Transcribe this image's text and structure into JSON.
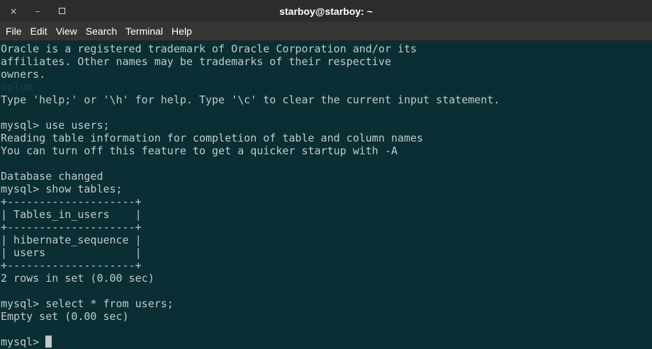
{
  "window": {
    "title": "starboy@starboy: ~",
    "controls": {
      "close_glyph": "×",
      "minimize_glyph": "–"
    }
  },
  "menubar": {
    "items": [
      "File",
      "Edit",
      "View",
      "Search",
      "Terminal",
      "Help"
    ]
  },
  "terminal": {
    "lines": [
      "Oracle is a registered trademark of Oracle Corporation and/or its",
      "affiliates. Other names may be trademarks of their respective",
      "owners.",
      "colum",
      "Type 'help;' or '\\h' for help. Type '\\c' to clear the current input statement.",
      "",
      "mysql> use users;",
      "Reading table information for completion of table and column names",
      "You can turn off this feature to get a quicker startup with -A",
      "",
      "Database changed",
      "mysql> show tables;",
      "+--------------------+",
      "| Tables_in_users    |",
      "+--------------------+",
      "| hibernate_sequence |",
      "| users              |",
      "+--------------------+",
      "2 rows in set (0.00 sec)",
      "",
      "mysql> select * from users;",
      "Empty set (0.00 sec)",
      ""
    ],
    "ghost_line_index": 3,
    "prompt": "mysql> "
  },
  "colors": {
    "background": "#0a2e33",
    "text": "#c2c9c9",
    "titlebar": "#2c2c2a",
    "menubar": "#353533"
  }
}
